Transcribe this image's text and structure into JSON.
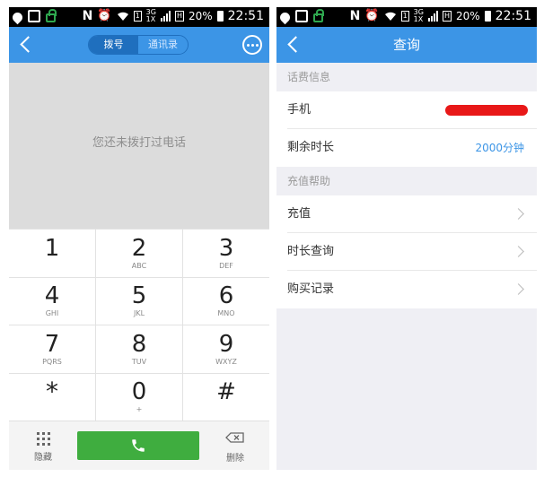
{
  "status_bar": {
    "network": "3G",
    "network_sub": "1X",
    "battery": "20%",
    "time": "22:51"
  },
  "dialer": {
    "tabs": [
      "拨号",
      "通讯录"
    ],
    "empty_message": "您还未拨打过电话",
    "keys": [
      {
        "digit": "1",
        "letters": ""
      },
      {
        "digit": "2",
        "letters": "ABC"
      },
      {
        "digit": "3",
        "letters": "DEF"
      },
      {
        "digit": "4",
        "letters": "GHI"
      },
      {
        "digit": "5",
        "letters": "JKL"
      },
      {
        "digit": "6",
        "letters": "MNO"
      },
      {
        "digit": "7",
        "letters": "PQRS"
      },
      {
        "digit": "8",
        "letters": "TUV"
      },
      {
        "digit": "9",
        "letters": "WXYZ"
      },
      {
        "digit": "*",
        "letters": ""
      },
      {
        "digit": "0",
        "letters": "+"
      },
      {
        "digit": "#",
        "letters": ""
      }
    ],
    "hide_label": "隐藏",
    "delete_label": "删除",
    "call_color": "#3fad3f"
  },
  "query": {
    "title": "查询",
    "section_fee": "话费信息",
    "phone_label": "手机",
    "remaining_label": "剩余时长",
    "remaining_value": "2000分钟",
    "section_help": "充值帮助",
    "menu": [
      "充值",
      "时长查询",
      "购买记录"
    ]
  },
  "colors": {
    "brand": "#3c95e6",
    "accent_text": "#3c95e6",
    "redaction": "#e81818"
  }
}
